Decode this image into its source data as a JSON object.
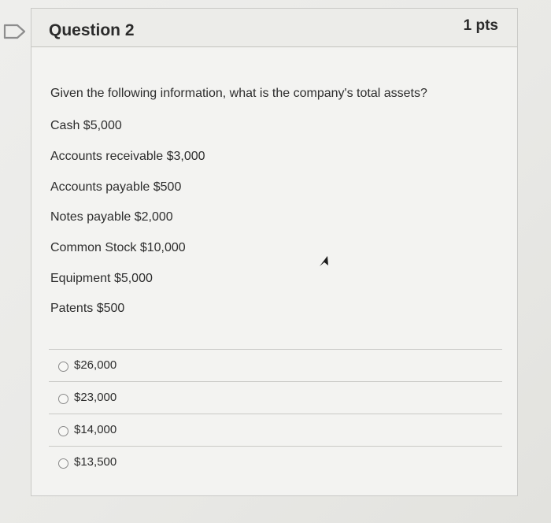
{
  "question": {
    "title": "Question 2",
    "points": "1 pts",
    "prompt": "Given the following information, what is the company's total assets?",
    "info": [
      "Cash $5,000",
      "Accounts receivable  $3,000",
      "Accounts payable  $500",
      "Notes payable $2,000",
      "Common Stock $10,000",
      "Equipment  $5,000",
      "Patents  $500"
    ],
    "answers": [
      "$26,000",
      "$23,000",
      "$14,000",
      "$13,500"
    ]
  },
  "colors": {
    "background": "#eeeeec",
    "card": "#f3f3f1",
    "border": "#c9c9c6",
    "text": "#2d2d2d"
  },
  "icons": {
    "flag": "flag-icon",
    "cursor": "cursor-icon"
  }
}
